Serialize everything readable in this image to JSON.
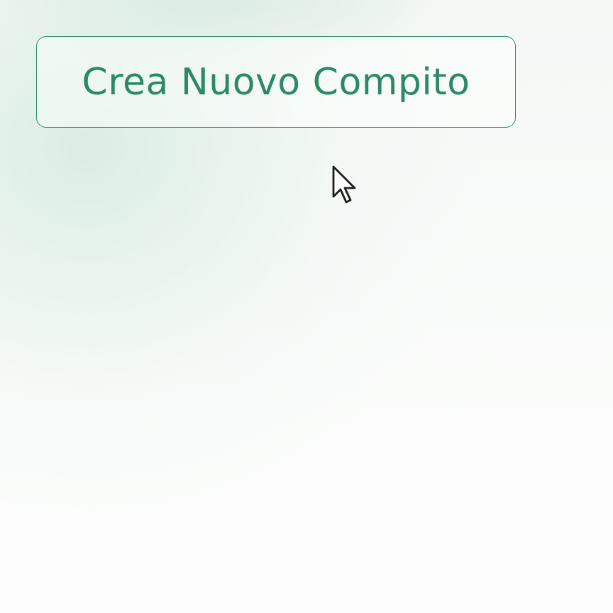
{
  "actions": {
    "create_task_label": "Crea Nuovo Compito"
  },
  "cursor": {
    "icon": "arrow-cursor-icon"
  },
  "colors": {
    "accent": "#2a8a64",
    "border": "#2f8f6b",
    "background": "#fbfcfb"
  }
}
